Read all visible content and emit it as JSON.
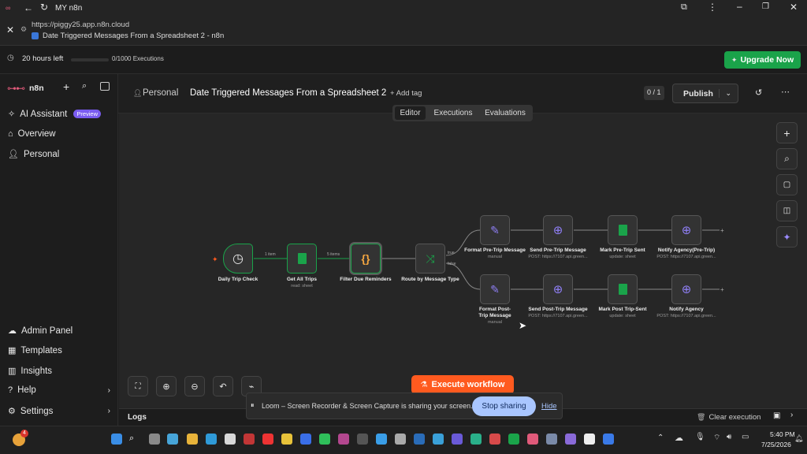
{
  "browser": {
    "app_title": "MY n8n",
    "url": "https://piggy25.app.n8n.cloud",
    "page_title": "Date Triggered Messages From a Spreadsheet 2 - n8n"
  },
  "trial": {
    "time_left": "20 hours left",
    "executions": "0/1000 Executions",
    "upgrade_label": "Upgrade Now"
  },
  "sidebar": {
    "logo_text": "n8n",
    "items": [
      {
        "label": "AI Assistant",
        "badge": "Preview"
      },
      {
        "label": "Overview"
      },
      {
        "label": "Personal"
      }
    ],
    "bottom_items": [
      {
        "label": "Admin Panel"
      },
      {
        "label": "Templates"
      },
      {
        "label": "Insights"
      },
      {
        "label": "Help"
      },
      {
        "label": "Settings"
      }
    ]
  },
  "header": {
    "project": "Personal",
    "workflow_name": "Date Triggered Messages From a Spreadsheet 2",
    "add_tag": "+ Add tag",
    "version": "0 / 1",
    "publish_label": "Publish",
    "tabs": [
      {
        "label": "Editor"
      },
      {
        "label": "Executions"
      },
      {
        "label": "Evaluations"
      }
    ]
  },
  "workflow": {
    "nodes": [
      {
        "label": "Daily Trip Check",
        "sub": ""
      },
      {
        "label": "Get All Trips",
        "sub": "read: sheet"
      },
      {
        "label": "Filter Due Reminders",
        "sub": ""
      },
      {
        "label": "Route by Message Type",
        "sub": ""
      },
      {
        "label": "Format Pre-Trip Message",
        "sub": "manual"
      },
      {
        "label": "Send Pre-Trip Message",
        "sub": "POST: https://7107.api.green..."
      },
      {
        "label": "Mark Pre-Trip Sent",
        "sub": "update: sheet"
      },
      {
        "label": "Notify Agency(Pre-Trip)",
        "sub": "POST: https://7107.api.green..."
      },
      {
        "label": "Format Post-Trip Message",
        "sub": "manual"
      },
      {
        "label": "Send Post-Trip Message",
        "sub": "POST: https://7107.api.green..."
      },
      {
        "label": "Mark Post Trip-Sent",
        "sub": "update: sheet"
      },
      {
        "label": "Notify Agency",
        "sub": "POST: https://7107.api.green..."
      }
    ],
    "edge_labels": [
      "1 item",
      "5 items",
      "true",
      "false"
    ]
  },
  "canvas": {
    "execute_label": "Execute workflow"
  },
  "logs": {
    "label": "Logs",
    "clear_label": "Clear execution"
  },
  "loom": {
    "message": "Loom – Screen Recorder & Screen Capture is sharing your screen.",
    "stop_label": "Stop sharing",
    "hide_label": "Hide"
  },
  "taskbar": {
    "time": "5:40 PM",
    "date": "7/25/2026",
    "notification_count": "4"
  },
  "colors": {
    "accent_green": "#1aa34a",
    "execute_orange": "#ff5a1f",
    "badge_purple": "#7a5cf0",
    "loom_button": "#a9c6ff"
  }
}
